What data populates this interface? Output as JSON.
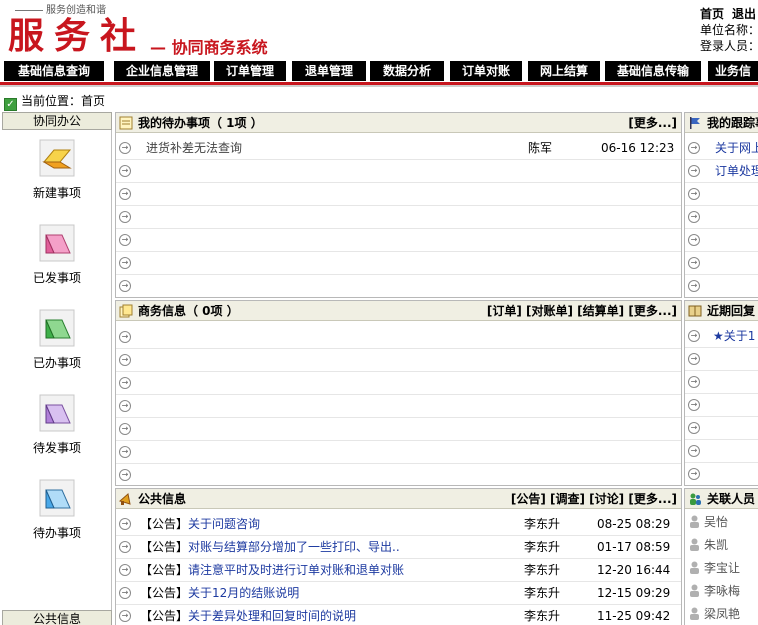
{
  "header": {
    "slogan": "服务创造和谐",
    "brand": "服务社",
    "subtitle": "— 协同商务系统",
    "links": [
      "首页",
      "退出"
    ],
    "unit_label": "单位名称：",
    "login_label": "登录人员："
  },
  "nav": {
    "items": [
      "基础信息查询",
      "企业信息管理",
      "订单管理",
      "退单管理",
      "数据分析",
      "订单对账",
      "网上结算",
      "基础信息传输",
      "业务信"
    ]
  },
  "location": {
    "label": "当前位置：首页"
  },
  "sidebar": {
    "head": "协同办公",
    "items": [
      {
        "label": "新建事项",
        "color": "#f0a020"
      },
      {
        "label": "已发事项",
        "color": "#e0609a"
      },
      {
        "label": "已办事项",
        "color": "#3fb04a"
      },
      {
        "label": "待发事项",
        "color": "#b080d8"
      },
      {
        "label": "待办事项",
        "color": "#4aa8e8"
      }
    ],
    "footer": "公共信息"
  },
  "todo": {
    "title": "我的待办事项（ 1项 ）",
    "more": "[更多...]",
    "rows": [
      {
        "text": "进货补差无法查询",
        "who": "陈军",
        "when": "06-16 12:23"
      }
    ]
  },
  "business": {
    "title": "商务信息（ 0项 ）",
    "links": [
      "[订单]",
      "[对账单]",
      "[结算单]",
      "[更多...]"
    ]
  },
  "public": {
    "title": "公共信息",
    "links": [
      "[公告]",
      "[调查]",
      "[讨论]",
      "[更多...]"
    ],
    "rows": [
      {
        "tag": "【公告】",
        "text": "关于问题咨询",
        "who": "李东升",
        "when": "08-25 08:29"
      },
      {
        "tag": "【公告】",
        "text": "对账与结算部分增加了一些打印、导出..",
        "who": "李东升",
        "when": "01-17 08:59"
      },
      {
        "tag": "【公告】",
        "text": "请注意平时及时进行订单对账和退单对账",
        "who": "李东升",
        "when": "12-20 16:44"
      },
      {
        "tag": "【公告】",
        "text": "关于12月的结账说明",
        "who": "李东升",
        "when": "12-15 09:29"
      },
      {
        "tag": "【公告】",
        "text": "关于差异处理和回复时间的说明",
        "who": "李东升",
        "when": "11-25 09:42"
      }
    ]
  },
  "tracking": {
    "title": "我的跟踪事",
    "rows": [
      "关于网上",
      "订单处理"
    ]
  },
  "recent": {
    "title": "近期回复",
    "rows": [
      "★关于1"
    ]
  },
  "contacts": {
    "title": "关联人员",
    "people": [
      "吴怡",
      "朱凯",
      "李宝让",
      "李咏梅",
      "梁凤艳"
    ]
  }
}
